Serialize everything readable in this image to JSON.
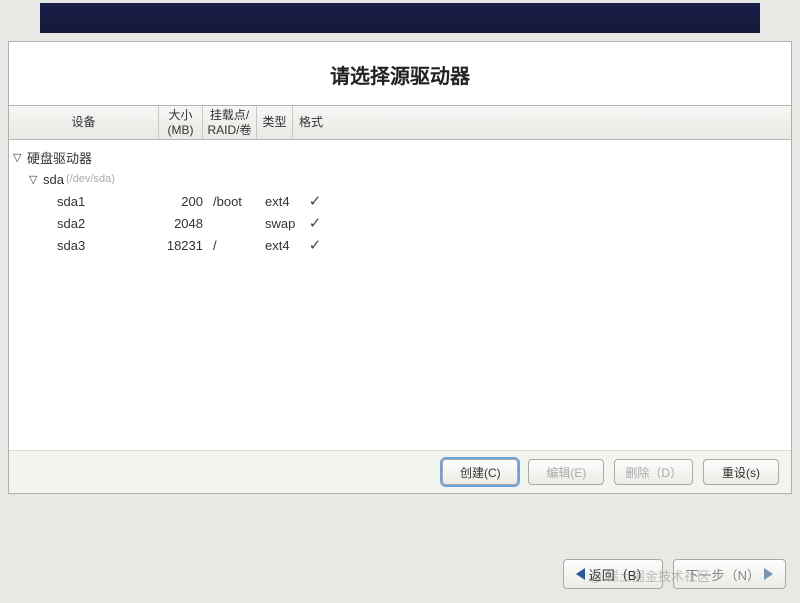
{
  "title": "请选择源驱动器",
  "columns": {
    "device": "设备",
    "size": "大小\n(MB)",
    "mount": "挂载点/\nRAID/卷",
    "type": "类型",
    "format": "格式"
  },
  "tree": {
    "root_label": "硬盘驱动器",
    "disk": {
      "name": "sda",
      "path": "(/dev/sda)"
    },
    "partitions": [
      {
        "name": "sda1",
        "size": "200",
        "mount": "/boot",
        "type": "ext4",
        "format": true
      },
      {
        "name": "sda2",
        "size": "2048",
        "mount": "",
        "type": "swap",
        "format": true
      },
      {
        "name": "sda3",
        "size": "18231",
        "mount": "/",
        "type": "ext4",
        "format": true
      }
    ]
  },
  "buttons": {
    "create": "创建(C)",
    "edit": "编辑(E)",
    "delete": "删除（D）",
    "reset": "重设(s)"
  },
  "nav": {
    "back": "返回（B）",
    "next": "下一步（N）"
  },
  "watermark": "@ 稀土掘金技术社区"
}
